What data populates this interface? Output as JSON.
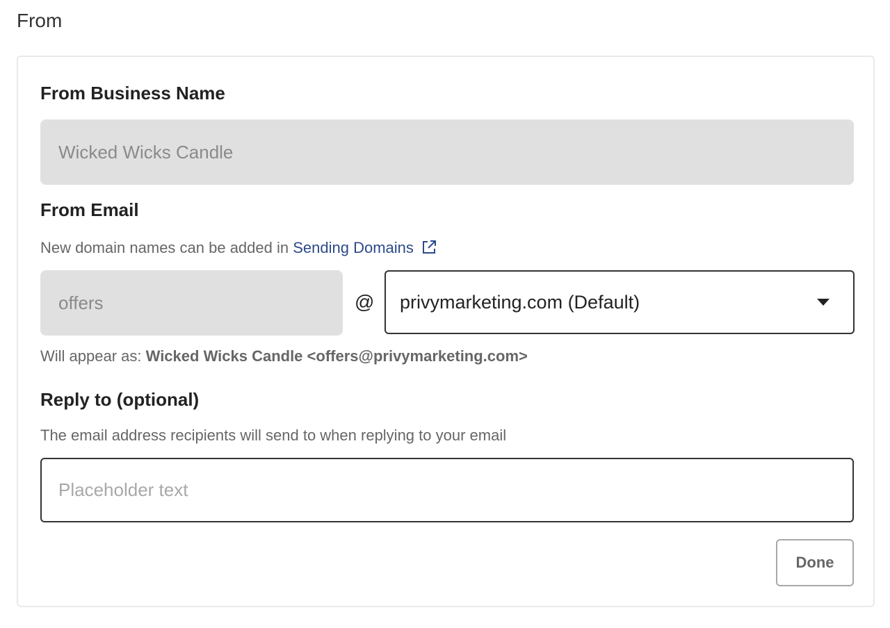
{
  "section": {
    "title": "From"
  },
  "business_name": {
    "label": "From Business Name",
    "value": "Wicked Wicks Candle"
  },
  "from_email": {
    "label": "From Email",
    "helper_prefix": "New domain names can be added in ",
    "helper_link": "Sending Domains",
    "local_part": "offers",
    "at": "@",
    "domain_selected": "privymarketing.com (Default)",
    "appear_label": "Will appear as: ",
    "appear_value": "Wicked Wicks Candle <offers@privymarketing.com>"
  },
  "reply_to": {
    "label": "Reply to (optional)",
    "helper": "The email address recipients will send to when replying to your email",
    "placeholder": "Placeholder text",
    "value": ""
  },
  "actions": {
    "done_label": "Done"
  },
  "icons": {
    "external_link": "external-link-icon",
    "dropdown": "caret-down-icon"
  },
  "colors": {
    "link": "#2d4a8a",
    "disabled_bg": "#e0e0e0",
    "border_dark": "#333333"
  }
}
